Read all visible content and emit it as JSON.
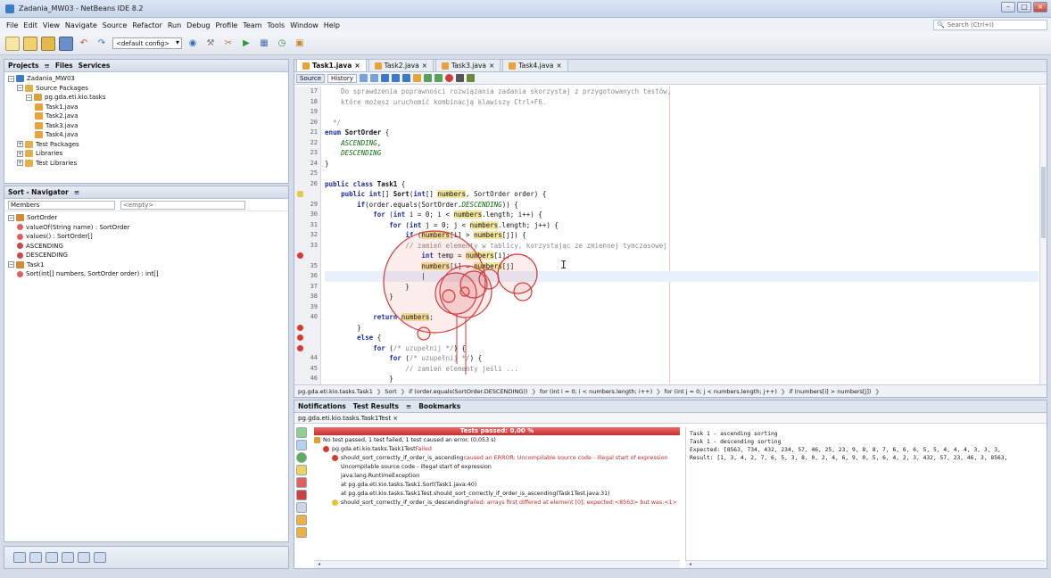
{
  "window": {
    "title": "Zadania_MW03 - NetBeans IDE 8.2",
    "controls": [
      "–",
      "□",
      "×"
    ]
  },
  "menu": [
    "File",
    "Edit",
    "View",
    "Navigate",
    "Source",
    "Refactor",
    "Run",
    "Debug",
    "Profile",
    "Team",
    "Tools",
    "Window",
    "Help"
  ],
  "search": {
    "placeholder": "Search (Ctrl+I)"
  },
  "toolbar": {
    "config": "<default config>"
  },
  "projects": {
    "tabs": [
      "Projects",
      "Files",
      "Services"
    ],
    "tree": [
      {
        "label": "Zadania_MW03",
        "level": 0,
        "type": "project"
      },
      {
        "label": "Source Packages",
        "level": 1,
        "type": "folder"
      },
      {
        "label": "pg.gda.eti.kio.tasks",
        "level": 2,
        "type": "package"
      },
      {
        "label": "Task1.java",
        "level": 3,
        "type": "java"
      },
      {
        "label": "Task2.java",
        "level": 3,
        "type": "java"
      },
      {
        "label": "Task3.java",
        "level": 3,
        "type": "java"
      },
      {
        "label": "Task4.java",
        "level": 3,
        "type": "java"
      },
      {
        "label": "Test Packages",
        "level": 1,
        "type": "folder"
      },
      {
        "label": "Libraries",
        "level": 1,
        "type": "folder"
      },
      {
        "label": "Test Libraries",
        "level": 1,
        "type": "folder"
      }
    ]
  },
  "navigator": {
    "title": "Sort - Navigator",
    "members_label": "Members",
    "filter": "<empty>",
    "items": [
      {
        "label": "SortOrder",
        "level": 0,
        "type": "class"
      },
      {
        "label": "valueOf(String name) : SortOrder",
        "level": 1,
        "type": "method"
      },
      {
        "label": "values() : SortOrder[]",
        "level": 1,
        "type": "method"
      },
      {
        "label": "ASCENDING",
        "level": 1,
        "type": "field"
      },
      {
        "label": "DESCENDING",
        "level": 1,
        "type": "field"
      },
      {
        "label": "Task1",
        "level": 0,
        "type": "class"
      },
      {
        "label": "Sort(int[] numbers, SortOrder order) : int[]",
        "level": 1,
        "type": "method"
      }
    ]
  },
  "editor": {
    "tabs": [
      "Task1.java",
      "Task2.java",
      "Task3.java",
      "Task4.java"
    ],
    "source_label": "Source",
    "history_label": "History",
    "gutter": [
      {
        "n": "17",
        "m": ""
      },
      {
        "n": "18",
        "m": ""
      },
      {
        "n": "19",
        "m": ""
      },
      {
        "n": "20",
        "m": ""
      },
      {
        "n": "21",
        "m": ""
      },
      {
        "n": "22",
        "m": ""
      },
      {
        "n": "23",
        "m": ""
      },
      {
        "n": "24",
        "m": ""
      },
      {
        "n": "25",
        "m": ""
      },
      {
        "n": "26",
        "m": ""
      },
      {
        "n": "",
        "m": "bulb"
      },
      {
        "n": "29",
        "m": ""
      },
      {
        "n": "30",
        "m": ""
      },
      {
        "n": "31",
        "m": ""
      },
      {
        "n": "32",
        "m": ""
      },
      {
        "n": "33",
        "m": ""
      },
      {
        "n": "",
        "m": "err"
      },
      {
        "n": "35",
        "m": ""
      },
      {
        "n": "36",
        "m": ""
      },
      {
        "n": "37",
        "m": ""
      },
      {
        "n": "38",
        "m": ""
      },
      {
        "n": "39",
        "m": ""
      },
      {
        "n": "40",
        "m": ""
      },
      {
        "n": "",
        "m": "err"
      },
      {
        "n": "",
        "m": "err"
      },
      {
        "n": "",
        "m": "err"
      },
      {
        "n": "44",
        "m": ""
      },
      {
        "n": "45",
        "m": ""
      },
      {
        "n": "46",
        "m": ""
      }
    ],
    "lines": [
      "<span class=\"cm\">    Do sprawdzenia poprawności rozwiązania zadania skorzystaj z przygotowanych testów,</span>",
      "<span class=\"cm\">    które możesz uruchomić kombinacją klawiszy Ctrl+F6.</span>",
      "",
      "<span class=\"cm\">  */</span>",
      "<span class=\"kw\">enum</span> <b>SortOrder</b> {",
      "    <span class=\"en\">ASCENDING</span>,",
      "    <span class=\"en\">DESCENDING</span>",
      "}",
      "",
      "<span class=\"kw\">public class</span> <b>Task1</b> {",
      "    <span class=\"kw\">public int</span>[] <b>Sort</b>(<span class=\"kw\">int</span>[] <span class=\"hl\">numbers</span>, SortOrder order) {",
      "        <span class=\"kw\">if</span>(order.equals(SortOrder.<span class=\"en\">DESCENDING</span>)) {",
      "            <span class=\"kw\">for</span> (<span class=\"kw\">int</span> i = 0; i &lt; <span class=\"hl\">numbers</span>.length; i++) {",
      "                <span class=\"kw\">for</span> (<span class=\"kw\">int</span> j = 0; j &lt; <span class=\"hl\">numbers</span>.length; j++) {",
      "                    <span class=\"kw\">if</span> (<span class=\"hl\">numbers</span>[i] &gt; <span class=\"hl\">numbers</span>[j]) {",
      "<span class=\"cm\">                    // zamień elementy w tablicy, korzystając ze zmiennej tymczasowej</span>",
      "                        <span class=\"kw\">int</span> temp = <span class=\"hl\">numbers</span>[i];",
      "                        <span class=\"hl\">numbers</span>[i] = <span class=\"hl\">numbers</span>[j]",
      "                        |",
      "                    }",
      "                }",
      "",
      "            <span class=\"kw\">return</span> <span class=\"hl\">numbers</span>;",
      "        }",
      "        <span class=\"kw\">else</span> {",
      "            <span class=\"kw\">for</span> (<span class=\"cm\">/* uzupełnij */</span>) {",
      "                <span class=\"kw\">for</span> (<span class=\"cm\">/* uzupełnij */</span>) {",
      "<span class=\"cm\">                    // zamień elementy jeśli ...</span>",
      "                }"
    ],
    "breadcrumb": [
      "pg.gda.eti.kio.tasks.Task1",
      "Sort",
      "if (order.equals(SortOrder.DESCENDING))",
      "for (int i = 0; i < numbers.length; i++)",
      "for (int j = 0; j < numbers.length; j++)",
      "if (numbers[i] > numbers[j])"
    ]
  },
  "tests": {
    "tabs": [
      "Notifications",
      "Test Results",
      "Bookmarks"
    ],
    "suite": "pg.gda.eti.kio.tasks.Task1Test",
    "bar_label": "Tests passed: 0,00 %",
    "summary": "No test passed, 1 test failed, 1 test caused an error. (0,053 s)",
    "rows": [
      {
        "text": "pg.gda.eti.kio.tasks.Task1Test",
        "extra": "Failed",
        "level": 1,
        "icon": "error"
      },
      {
        "text": "should_sort_correctly_if_order_is_ascending",
        "extra": "caused an ERROR: Uncompilable source code - illegal start of expression",
        "level": 2,
        "icon": "error"
      },
      {
        "text": "Uncompilable source code - illegal start of expression",
        "extra": "",
        "level": 3,
        "icon": ""
      },
      {
        "text": "java.lang.RuntimeException",
        "extra": "",
        "level": 3,
        "icon": ""
      },
      {
        "text": "at pg.gda.eti.kio.tasks.Task1.Sort(Task1.java:40)",
        "extra": "",
        "level": 3,
        "icon": ""
      },
      {
        "text": "at pg.gda.eti.kio.tasks.Task1Test.should_sort_correctly_if_order_is_ascending(Task1Test.java:31)",
        "extra": "",
        "level": 3,
        "icon": ""
      },
      {
        "text": "should_sort_correctly_if_order_is_descending",
        "extra": "Failed: arrays first differed at element [0]; expected:<8563> but was:<1>",
        "level": 2,
        "icon": "warn"
      }
    ],
    "output": [
      "Task 1 - ascending sorting",
      "Task 1 - descending sorting",
      "Expected: [8563, 734, 432, 234, 57, 46, 25, 23, 9, 8, 8, 7, 6, 6, 6, 5, 5, 4, 4, 4, 3, 3, 3,",
      "Result: [1, 3, 4, 2, 7, 6, 5, 3, 8, 0, 2, 4, 6, 9, 0, 5, 6, 4, 2, 3, 432, 57, 23, 46, 3, 8563,"
    ]
  }
}
